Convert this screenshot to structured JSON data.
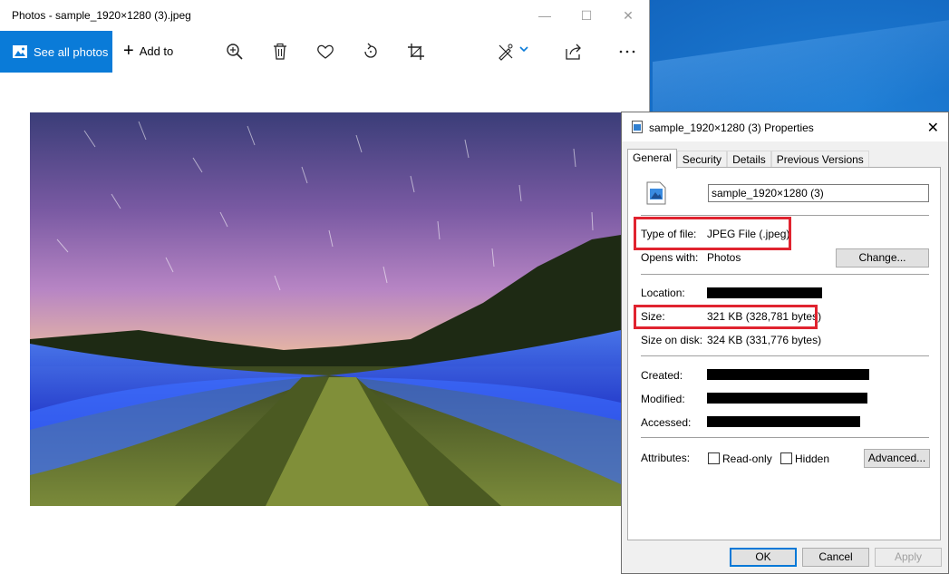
{
  "photos": {
    "window_title": "Photos - sample_1920×1280 (3).jpeg",
    "see_all_label": "See all photos",
    "add_to_label": "Add to",
    "toolbar_icons": [
      "zoom-in-icon",
      "delete-icon",
      "favorite-icon",
      "rotate-icon",
      "crop-icon",
      "edit-create-icon",
      "share-icon",
      "more-icon"
    ]
  },
  "dialog": {
    "title": "sample_1920×1280 (3) Properties",
    "tabs": [
      "General",
      "Security",
      "Details",
      "Previous Versions"
    ],
    "file_name": "sample_1920×1280 (3)",
    "type_label": "Type of file:",
    "type_value": "JPEG File (.jpeg)",
    "opens_label": "Opens with:",
    "opens_value": "Photos",
    "change_button": "Change...",
    "location_label": "Location:",
    "size_label": "Size:",
    "size_value": "321 KB (328,781 bytes)",
    "size_on_disk_label": "Size on disk:",
    "size_on_disk_value": "324 KB (331,776 bytes)",
    "created_label": "Created:",
    "modified_label": "Modified:",
    "accessed_label": "Accessed:",
    "attributes_label": "Attributes:",
    "readonly_label": "Read-only",
    "hidden_label": "Hidden",
    "advanced_button": "Advanced...",
    "ok_button": "OK",
    "cancel_button": "Cancel",
    "apply_button": "Apply"
  },
  "colors": {
    "accent": "#0a7bd8",
    "highlight": "#e0232f"
  }
}
